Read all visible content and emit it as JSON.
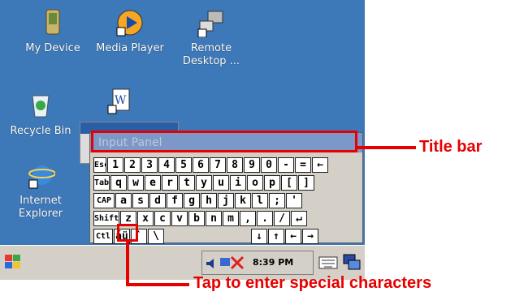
{
  "desktop": {
    "icons": [
      {
        "label": "My Device",
        "icon": "pda-device-icon"
      },
      {
        "label": "Media Player",
        "icon": "media-player-icon"
      },
      {
        "label": "Remote\nDesktop ...",
        "icon": "remote-desktop-icon"
      },
      {
        "label": "Recycle Bin",
        "icon": "recycle-bin-icon"
      },
      {
        "label": "",
        "icon": "document-shortcut-icon"
      },
      {
        "label": "Internet\nExplorer",
        "icon": "internet-explorer-icon"
      }
    ]
  },
  "input_panel": {
    "title": "Input Panel",
    "rows": [
      [
        "Esc",
        "1",
        "2",
        "3",
        "4",
        "5",
        "6",
        "7",
        "8",
        "9",
        "0",
        "-",
        "=",
        "←"
      ],
      [
        "Tab",
        "q",
        "w",
        "e",
        "r",
        "t",
        "y",
        "u",
        "i",
        "o",
        "p",
        "[",
        "]"
      ],
      [
        "CAP",
        "a",
        "s",
        "d",
        "f",
        "g",
        "h",
        "j",
        "k",
        "l",
        ";",
        "'"
      ],
      [
        "Shift",
        "z",
        "x",
        "c",
        "v",
        "b",
        "n",
        "m",
        ",",
        ".",
        "/",
        "↵"
      ],
      [
        "Ctl",
        "áü",
        "`",
        "\\",
        "↓",
        "↑",
        "←",
        "→"
      ]
    ]
  },
  "taskbar": {
    "clock": "8:39 PM",
    "start_icon": "windows-flag-icon",
    "tray_icons": [
      "speaker-icon",
      "network-icon"
    ],
    "keyboard_icon": "keyboard-icon",
    "switch_icon": "switch-window-icon"
  },
  "callouts": {
    "title_bar": "Title bar",
    "special_chars": "Tap to enter special characters"
  },
  "colors": {
    "desktop_bg": "#3d78b8",
    "callout": "#e60000",
    "panel_title_bg": "#7b98c8"
  }
}
